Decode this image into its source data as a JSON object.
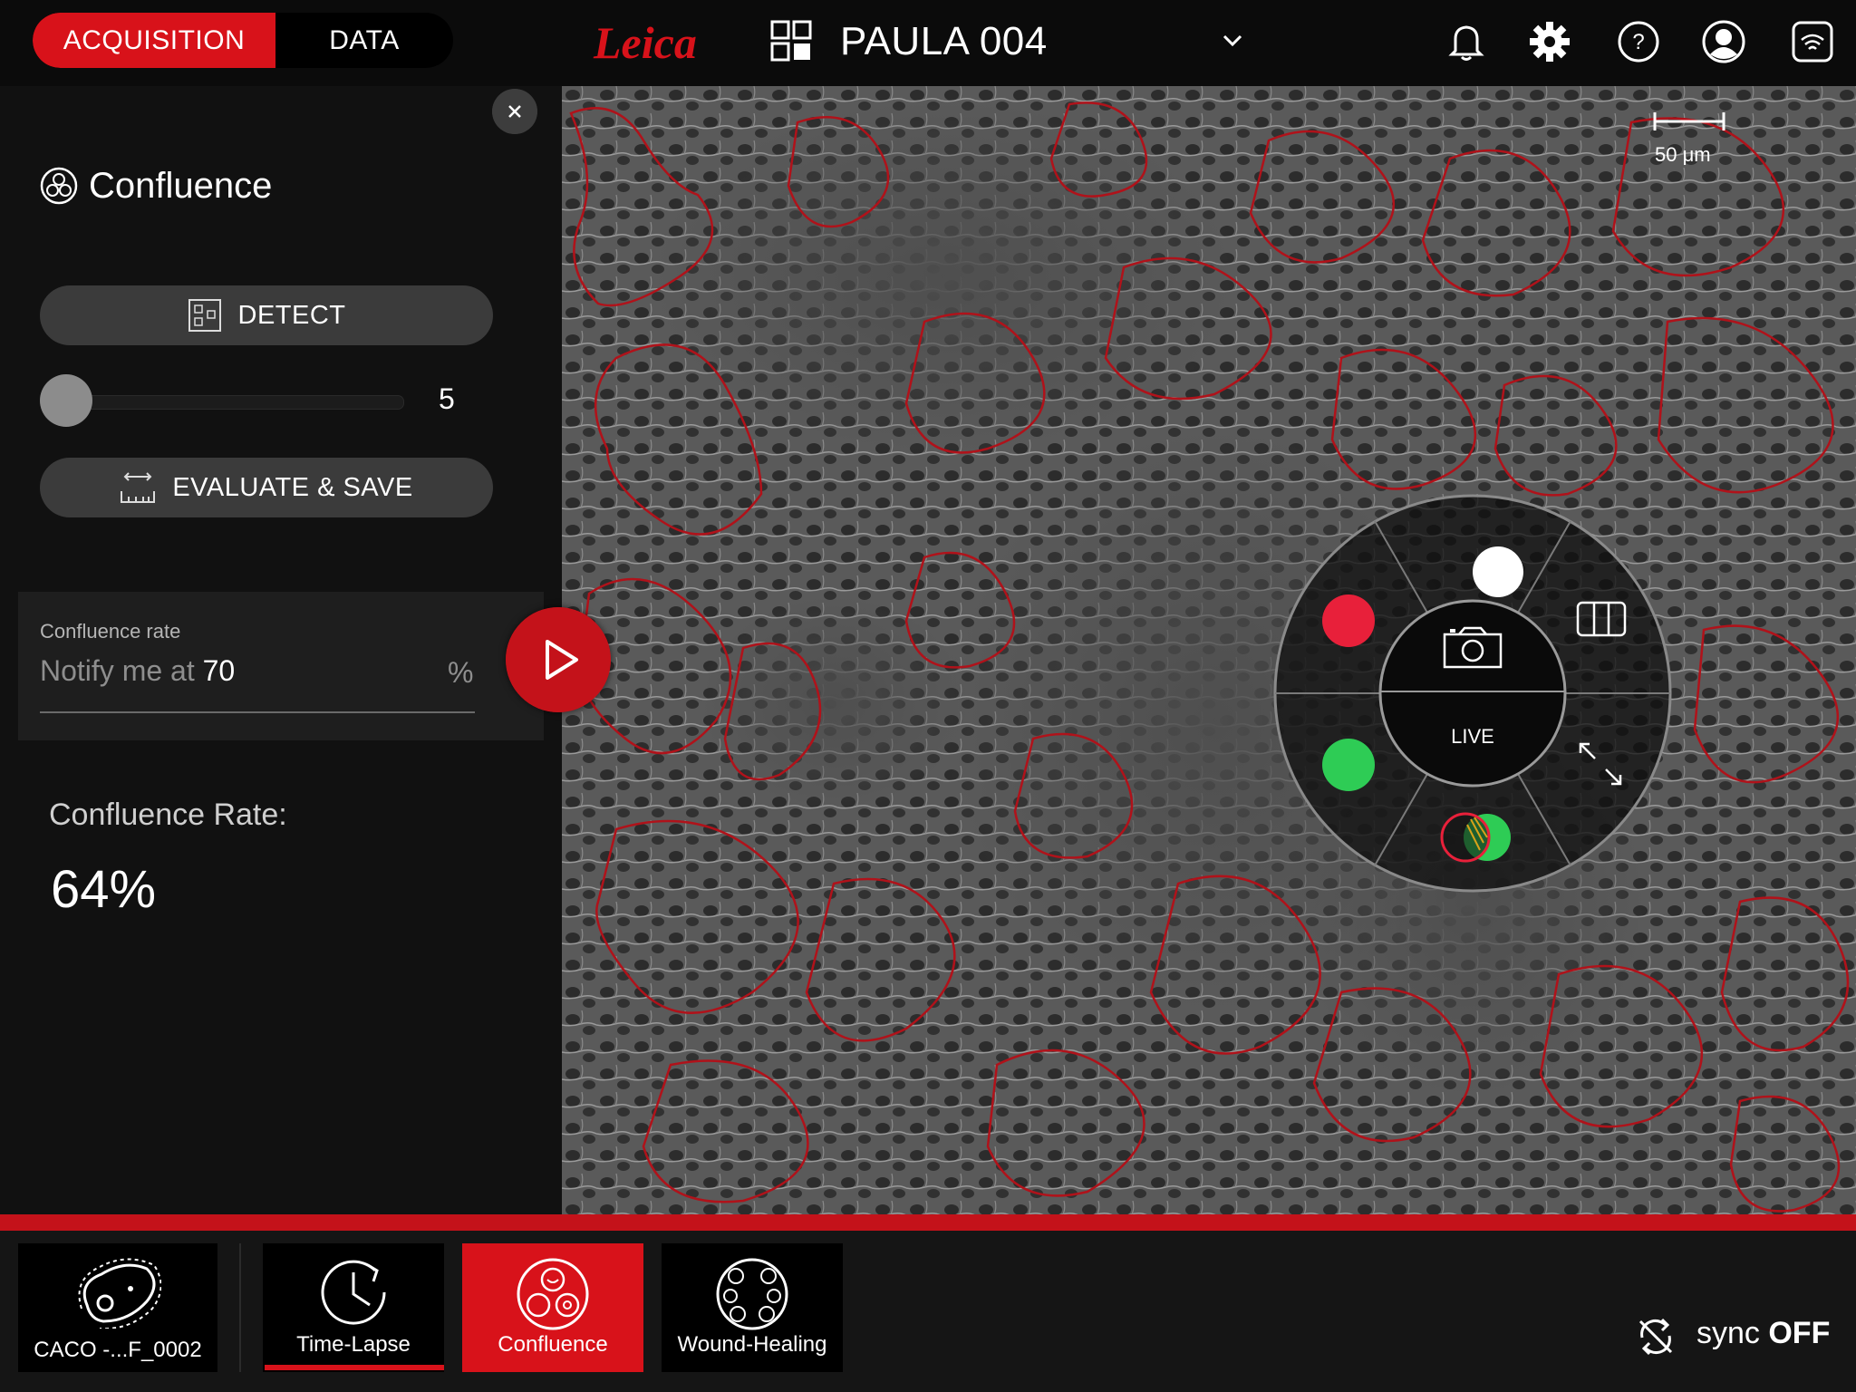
{
  "header": {
    "tabs": [
      {
        "label": "ACQUISITION",
        "active": true
      },
      {
        "label": "DATA",
        "active": false
      }
    ],
    "brand": "Leica",
    "project_name": "PAULA 004",
    "icons": [
      "bell-icon",
      "gear-icon",
      "help-icon",
      "user-icon",
      "wifi-icon"
    ]
  },
  "panel": {
    "title": "Confluence",
    "detect_label": "DETECT",
    "slider_value": "5",
    "evaluate_label": "EVALUATE & SAVE",
    "rate_label": "Confluence rate",
    "notify_prefix": "Notify me at ",
    "notify_value": "70",
    "notify_unit": "%",
    "result_label": "Confluence Rate:",
    "result_value": "64%"
  },
  "viewer": {
    "scale_label": "50 μm",
    "live_label": "LIVE",
    "channels": [
      {
        "name": "white",
        "color": "#ffffff"
      },
      {
        "name": "red",
        "color": "#e8203a"
      },
      {
        "name": "green",
        "color": "#2ecc55"
      }
    ]
  },
  "apps": [
    {
      "label": "CACO -...F_0002",
      "icon": "cell-icon",
      "active": false
    },
    {
      "label": "Time-Lapse",
      "icon": "clock-icon",
      "active": false
    },
    {
      "label": "Confluence",
      "icon": "confluence-icon",
      "active": true
    },
    {
      "label": "Wound-Healing",
      "icon": "wound-healing-icon",
      "active": false
    }
  ],
  "sync": {
    "prefix": "sync ",
    "state": "OFF"
  },
  "colors": {
    "accent": "#d8121a",
    "background": "#0b0b0b",
    "panel": "#111111"
  }
}
